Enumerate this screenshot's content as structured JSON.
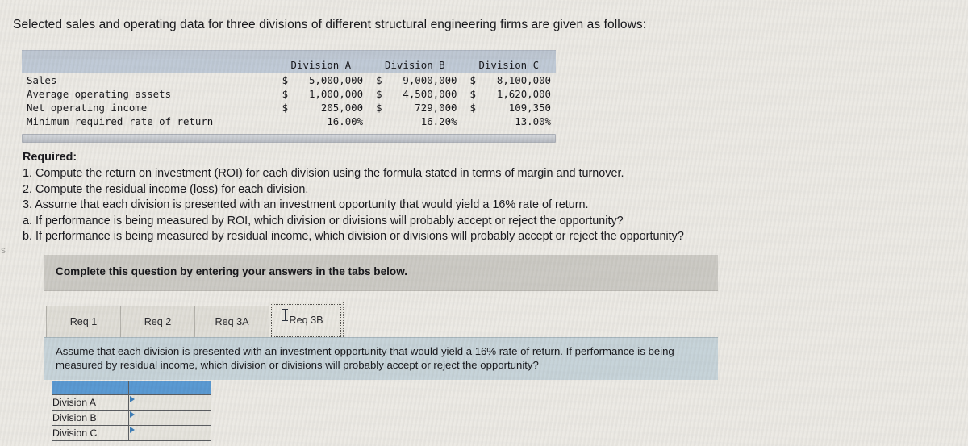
{
  "prompt": "Selected sales and operating data for three divisions of different structural engineering firms are given as follows:",
  "stray_char": "s",
  "data_table": {
    "columns": [
      "",
      "Division A",
      "Division B",
      "Division C"
    ],
    "rows": [
      {
        "label": "Sales",
        "values": [
          {
            "currency": "$",
            "amount": "5,000,000"
          },
          {
            "currency": "$",
            "amount": "9,000,000"
          },
          {
            "currency": "$",
            "amount": "8,100,000"
          }
        ]
      },
      {
        "label": "Average operating assets",
        "values": [
          {
            "currency": "$",
            "amount": "1,000,000"
          },
          {
            "currency": "$",
            "amount": "4,500,000"
          },
          {
            "currency": "$",
            "amount": "1,620,000"
          }
        ]
      },
      {
        "label": "Net operating income",
        "values": [
          {
            "currency": "$",
            "amount": "205,000"
          },
          {
            "currency": "$",
            "amount": "729,000"
          },
          {
            "currency": "$",
            "amount": "109,350"
          }
        ]
      },
      {
        "label": "Minimum required rate of return",
        "values": [
          {
            "currency": "",
            "amount": "16.00%"
          },
          {
            "currency": "",
            "amount": "16.20%"
          },
          {
            "currency": "",
            "amount": "13.00%"
          }
        ]
      }
    ]
  },
  "required": {
    "heading": "Required:",
    "items": [
      "1. Compute the return on investment (ROI) for each division using the formula stated in terms of margin and turnover.",
      "2. Compute the residual income (loss) for each division.",
      "3. Assume that each division is presented with an investment opportunity that would yield a 16% rate of return.",
      "a. If performance is being measured by ROI, which division or divisions will probably accept or reject the opportunity?",
      "b. If performance is being measured by residual income, which division or divisions will probably accept or reject the opportunity?"
    ]
  },
  "banner": {
    "text": "Complete this question by entering your answers in the tabs below."
  },
  "tabs": [
    {
      "label": "Req 1",
      "active": false
    },
    {
      "label": "Req 2",
      "active": false
    },
    {
      "label": "Req 3A",
      "active": false
    },
    {
      "label": "Req 3B",
      "active": true
    }
  ],
  "question_panel": {
    "text": "Assume that each division is presented with an investment opportunity that would yield a 16% rate of return. If performance is being measured by residual income, which division or divisions will probably accept or reject the opportunity?"
  },
  "answer_table": {
    "header": [
      "",
      ""
    ],
    "rows": [
      {
        "label": "Division A",
        "value": ""
      },
      {
        "label": "Division B",
        "value": ""
      },
      {
        "label": "Division C",
        "value": ""
      }
    ]
  },
  "colors": {
    "page_background": "#eeece7",
    "table_header_band": "#c2ccd9",
    "banner_grey": "#ceccc7",
    "question_panel_blue": "#c9d6dc",
    "answer_header_blue": "#5b9bd5",
    "dropdown_marker": "#3e7fba",
    "active_tab": "#eceae4"
  }
}
